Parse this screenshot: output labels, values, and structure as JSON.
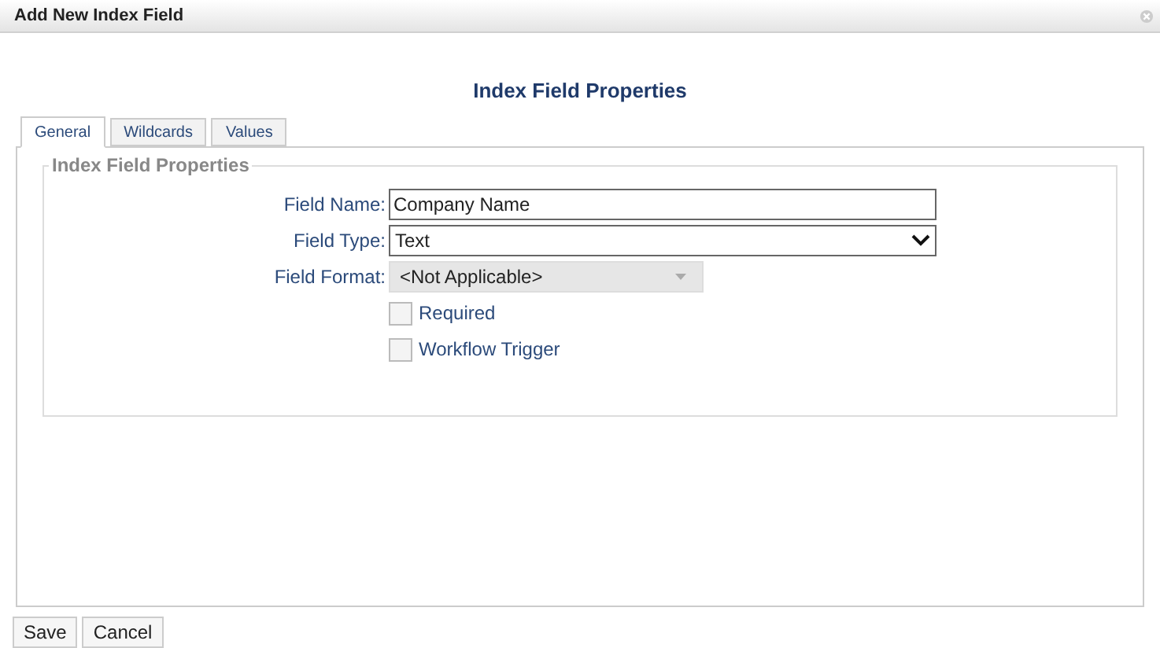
{
  "window": {
    "title": "Add New Index Field"
  },
  "heading": "Index Field Properties",
  "tabs": [
    {
      "label": "General",
      "selected": true
    },
    {
      "label": "Wildcards",
      "selected": false
    },
    {
      "label": "Values",
      "selected": false
    }
  ],
  "group": {
    "legend": "Index Field Properties",
    "fields": [
      {
        "kind": "text",
        "label": "Field Name:",
        "value": "Company Name",
        "disabled": false
      },
      {
        "kind": "select",
        "label": "Field Type:",
        "value": "Text",
        "disabled": false
      },
      {
        "kind": "select",
        "label": "Field Format:",
        "value": "<Not Applicable>",
        "disabled": true
      }
    ],
    "checkboxes": [
      {
        "label": "Required",
        "checked": false
      },
      {
        "label": "Workflow Trigger",
        "checked": false
      }
    ]
  },
  "buttons": [
    "Save",
    "Cancel"
  ]
}
